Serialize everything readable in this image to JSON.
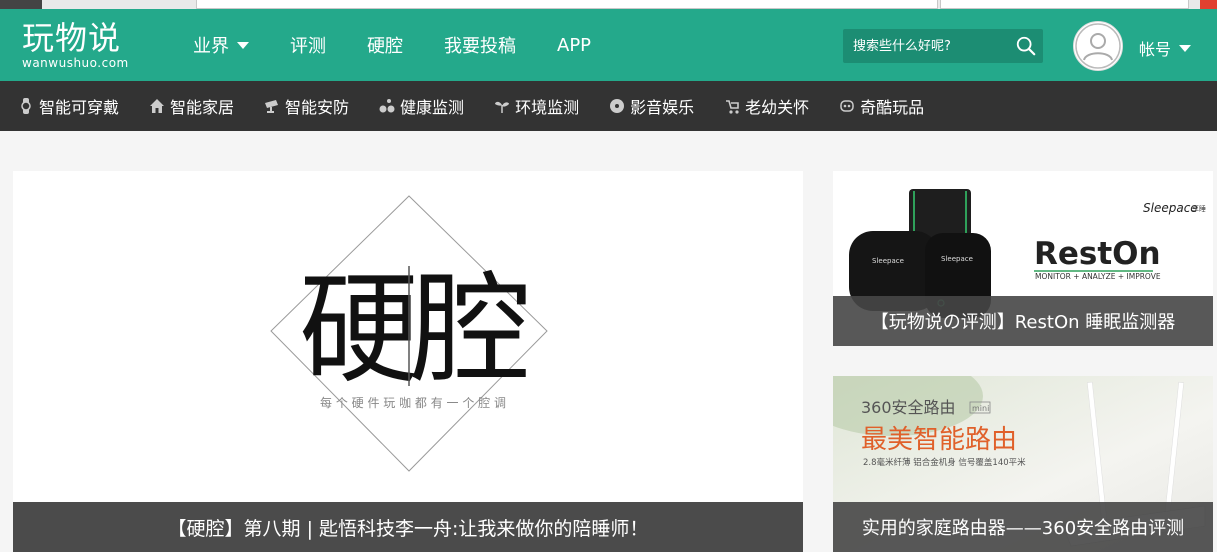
{
  "header": {
    "logo_main": "玩物说",
    "logo_sub": "wanwushuo.com",
    "nav": [
      {
        "label": "业界",
        "dropdown": true
      },
      {
        "label": "评测",
        "dropdown": false
      },
      {
        "label": "硬腔",
        "dropdown": false
      },
      {
        "label": "我要投稿",
        "dropdown": false
      },
      {
        "label": "APP",
        "dropdown": false
      }
    ],
    "search_placeholder": "搜索些什么好呢?",
    "account_label": "帐号"
  },
  "categories": [
    {
      "label": "智能可穿戴",
      "icon": "watch-icon"
    },
    {
      "label": "智能家居",
      "icon": "house-icon"
    },
    {
      "label": "智能安防",
      "icon": "camera-icon"
    },
    {
      "label": "健康监测",
      "icon": "bike-icon"
    },
    {
      "label": "环境监测",
      "icon": "sprout-icon"
    },
    {
      "label": "影音娱乐",
      "icon": "disc-icon"
    },
    {
      "label": "老幼关怀",
      "icon": "stroller-icon"
    },
    {
      "label": "奇酷玩品",
      "icon": "robot-icon"
    }
  ],
  "feature": {
    "art_title_left": "硬",
    "art_title_right": "腔",
    "art_tagline": "每 个 硬 件 玩 咖 都 有 一 个 腔 调",
    "caption": "【硬腔】第八期 | 匙悟科技李一舟:让我来做你的陪睡师！"
  },
  "side1": {
    "brand": "Sleepace",
    "brand_cn": "享睡",
    "product": "RestOn",
    "tagline": "MONITOR + ANALYZE + IMPROVE",
    "device_label": "Sleepace",
    "caption": "【玩物说の评测】RestOn 睡眠监测器"
  },
  "side2": {
    "ad_title": "360安全路由",
    "ad_mini": "mini",
    "ad_headline": "最美智能路由",
    "ad_sub": "2.8毫米纤薄 铝合金机身 信号覆盖140平米",
    "caption": "实用的家庭路由器——360安全路由评测"
  },
  "colors": {
    "brand_green": "#24a98b",
    "category_bar": "#333333",
    "caption_bg": "#3c3c3c",
    "ad_orange": "#e0602a"
  }
}
